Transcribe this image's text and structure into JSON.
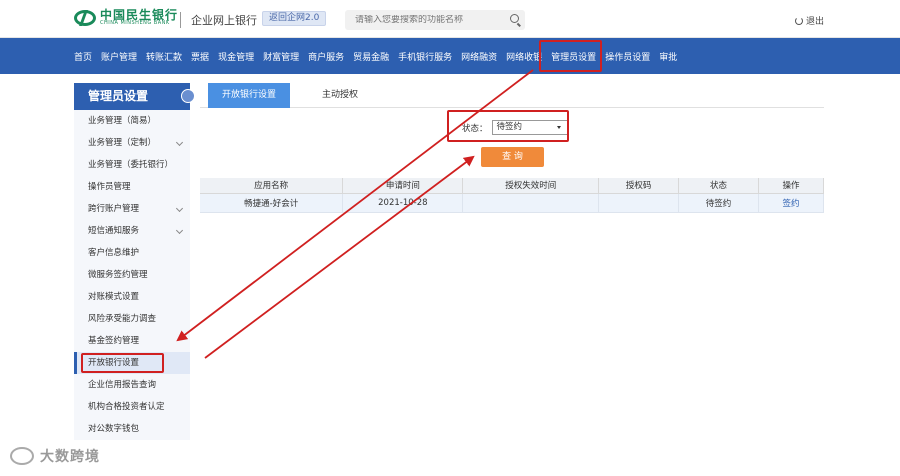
{
  "header": {
    "logo_cn": "中国民生银行",
    "logo_en": "CHINA MINSHENG BANK",
    "bank_name": "企业网上银行",
    "back_label": "返回企网2.0",
    "search_placeholder": "请输入您要搜索的功能名称",
    "logout_label": "退出"
  },
  "nav": {
    "items": [
      "首页",
      "账户管理",
      "转账汇款",
      "票据",
      "现金管理",
      "财富管理",
      "商户服务",
      "贸易金融",
      "手机银行服务",
      "网络融资",
      "网络收银",
      "管理员设置",
      "操作员设置",
      "审批"
    ]
  },
  "sidebar": {
    "title": "管理员设置",
    "items": [
      {
        "label": "业务管理（简易）"
      },
      {
        "label": "业务管理（定制）"
      },
      {
        "label": "业务管理（委托银行）"
      },
      {
        "label": "操作员管理"
      },
      {
        "label": "跨行账户管理"
      },
      {
        "label": "短信通知服务"
      },
      {
        "label": "客户信息维护"
      },
      {
        "label": "微服务签约管理"
      },
      {
        "label": "对账模式设置"
      },
      {
        "label": "风险承受能力调查"
      },
      {
        "label": "基金签约管理"
      },
      {
        "label": "开放银行设置"
      },
      {
        "label": "企业信用报告查询"
      },
      {
        "label": "机构合格投资者认定"
      },
      {
        "label": "对公数字钱包"
      }
    ]
  },
  "tabs": [
    "开放银行设置",
    "主动授权"
  ],
  "filter": {
    "status_label": "状态：",
    "status_value": "待签约",
    "query_label": "查 询"
  },
  "table": {
    "headers": [
      "应用名称",
      "申请时间",
      "授权失效时间",
      "授权码",
      "状态",
      "操作"
    ],
    "rows": [
      {
        "app": "畅捷通-好会计",
        "date": "2021-10-28",
        "expire": "",
        "code": "",
        "status": "待签约",
        "action": "签约"
      }
    ]
  },
  "watermark": "大数跨境",
  "colors": {
    "nav": "#2d5fb0",
    "accent": "#4a90e2",
    "button": "#f08a3a",
    "annotation": "#d02020"
  }
}
